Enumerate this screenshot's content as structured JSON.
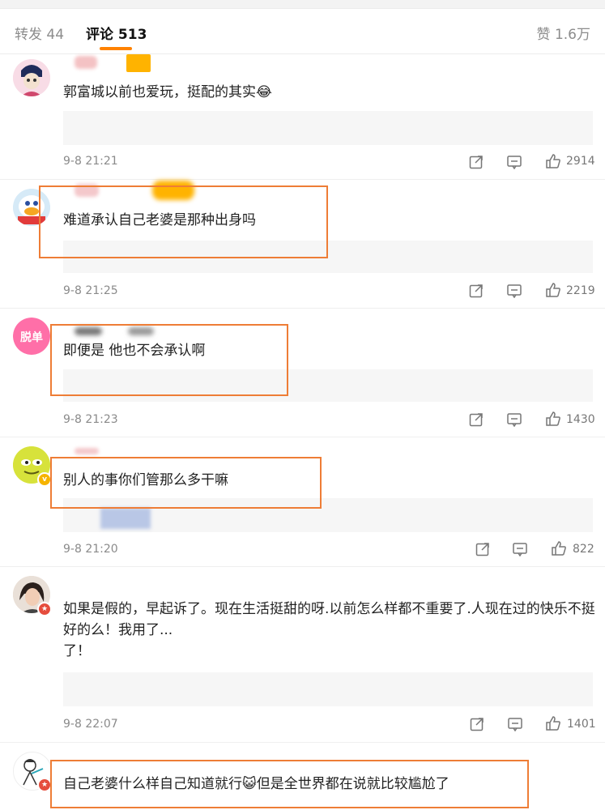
{
  "tabs": {
    "repost": "转发 44",
    "comments": "评论 513",
    "likes": "赞 1.6万"
  },
  "colors": {
    "accent": "#ff8200",
    "highlight": "#ee7d36"
  },
  "comments": [
    {
      "text": "郭富城以前也爱玩，挺配的其实😂",
      "time": "9-8 21:21",
      "likes": "2914"
    },
    {
      "text": "难道承认自己老婆是那种出身吗",
      "time": "9-8 21:25",
      "likes": "2219"
    },
    {
      "text": "即便是 他也不会承认啊",
      "time": "9-8 21:23",
      "likes": "1430"
    },
    {
      "text": "别人的事你们管那么多干嘛",
      "time": "9-8 21:20",
      "likes": "822"
    },
    {
      "text": "如果是假的，早起诉了。现在生活挺甜的呀.以前怎么样都不重要了.人现在过的快乐不挺好的么！我用了...",
      "text_line3": "了！",
      "time": "9-8 22:07",
      "likes": "1401"
    },
    {
      "text": "自己老婆什么样自己知道就行😺但是全世界都在说就比较尴尬了"
    }
  ],
  "icons": [
    "share-icon",
    "comment-icon",
    "like-icon"
  ]
}
